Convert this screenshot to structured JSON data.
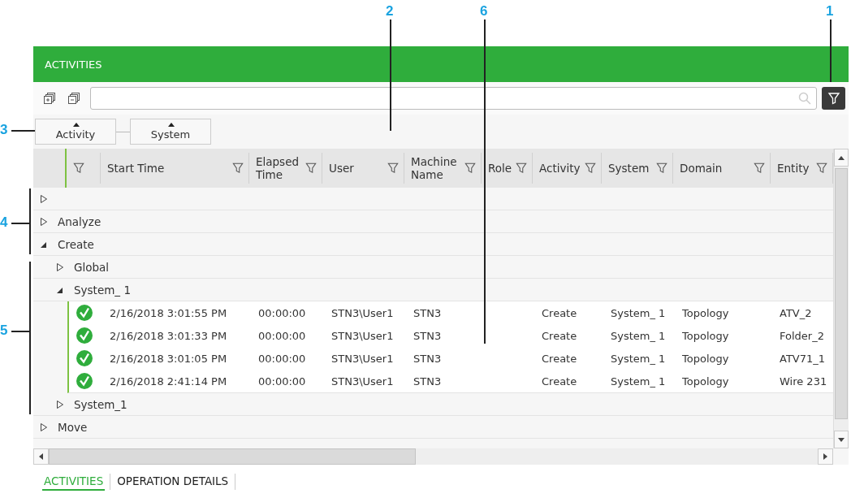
{
  "annotations": [
    {
      "label": "2"
    },
    {
      "label": "6"
    },
    {
      "label": "1"
    },
    {
      "label": "3"
    },
    {
      "label": "4"
    },
    {
      "label": "5"
    }
  ],
  "panel": {
    "title": "ACTIVITIES"
  },
  "group_by": [
    {
      "label": "Activity",
      "ascending": true
    },
    {
      "label": "System",
      "ascending": true
    }
  ],
  "table": {
    "columns": [
      {
        "kind": "status"
      },
      {
        "kind": "text",
        "label": "Start Time"
      },
      {
        "kind": "text",
        "label": "Elapsed Time"
      },
      {
        "kind": "text",
        "label": "User"
      },
      {
        "kind": "text",
        "label": "Machine Name"
      },
      {
        "kind": "text",
        "label": "Role"
      },
      {
        "kind": "text",
        "label": "Activity"
      },
      {
        "kind": "text",
        "label": "System"
      },
      {
        "kind": "text",
        "label": "Domain"
      },
      {
        "kind": "text",
        "label": "Entity"
      }
    ],
    "groups": [
      {
        "expanded": false
      },
      {
        "label": "Analyze",
        "expanded": false
      },
      {
        "label": "Create",
        "expanded": true,
        "children": [
          {
            "label": "Global",
            "expanded": false
          },
          {
            "label": "System_ 1",
            "expanded": true,
            "records": [
              {
                "succeeded": true,
                "start_time": "2/16/2018 3:01:55 PM",
                "elapsed": "00:00:00",
                "user": "STN3\\User1",
                "machine": "STN3",
                "activity": "Create",
                "system": "System_ 1",
                "domain": "Topology",
                "entity": "ATV_2"
              },
              {
                "succeeded": true,
                "start_time": "2/16/2018 3:01:33 PM",
                "elapsed": "00:00:00",
                "user": "STN3\\User1",
                "machine": "STN3",
                "activity": "Create",
                "system": "System_ 1",
                "domain": "Topology",
                "entity": "Folder_2"
              },
              {
                "succeeded": true,
                "start_time": "2/16/2018 3:01:05 PM",
                "elapsed": "00:00:00",
                "user": "STN3\\User1",
                "machine": "STN3",
                "activity": "Create",
                "system": "System_ 1",
                "domain": "Topology",
                "entity": "ATV71_1"
              },
              {
                "succeeded": true,
                "start_time": "2/16/2018 2:41:14 PM",
                "elapsed": "00:00:00",
                "user": "STN3\\User1",
                "machine": "STN3",
                "activity": "Create",
                "system": "System_ 1",
                "domain": "Topology",
                "entity": "Wire 231"
              }
            ]
          },
          {
            "label": "System_1",
            "expanded": false
          }
        ]
      },
      {
        "label": "Move",
        "expanded": false
      }
    ]
  },
  "tabs": [
    {
      "label": "ACTIVITIES",
      "selected": true
    },
    {
      "label": "OPERATION DETAILS",
      "selected": false
    }
  ]
}
